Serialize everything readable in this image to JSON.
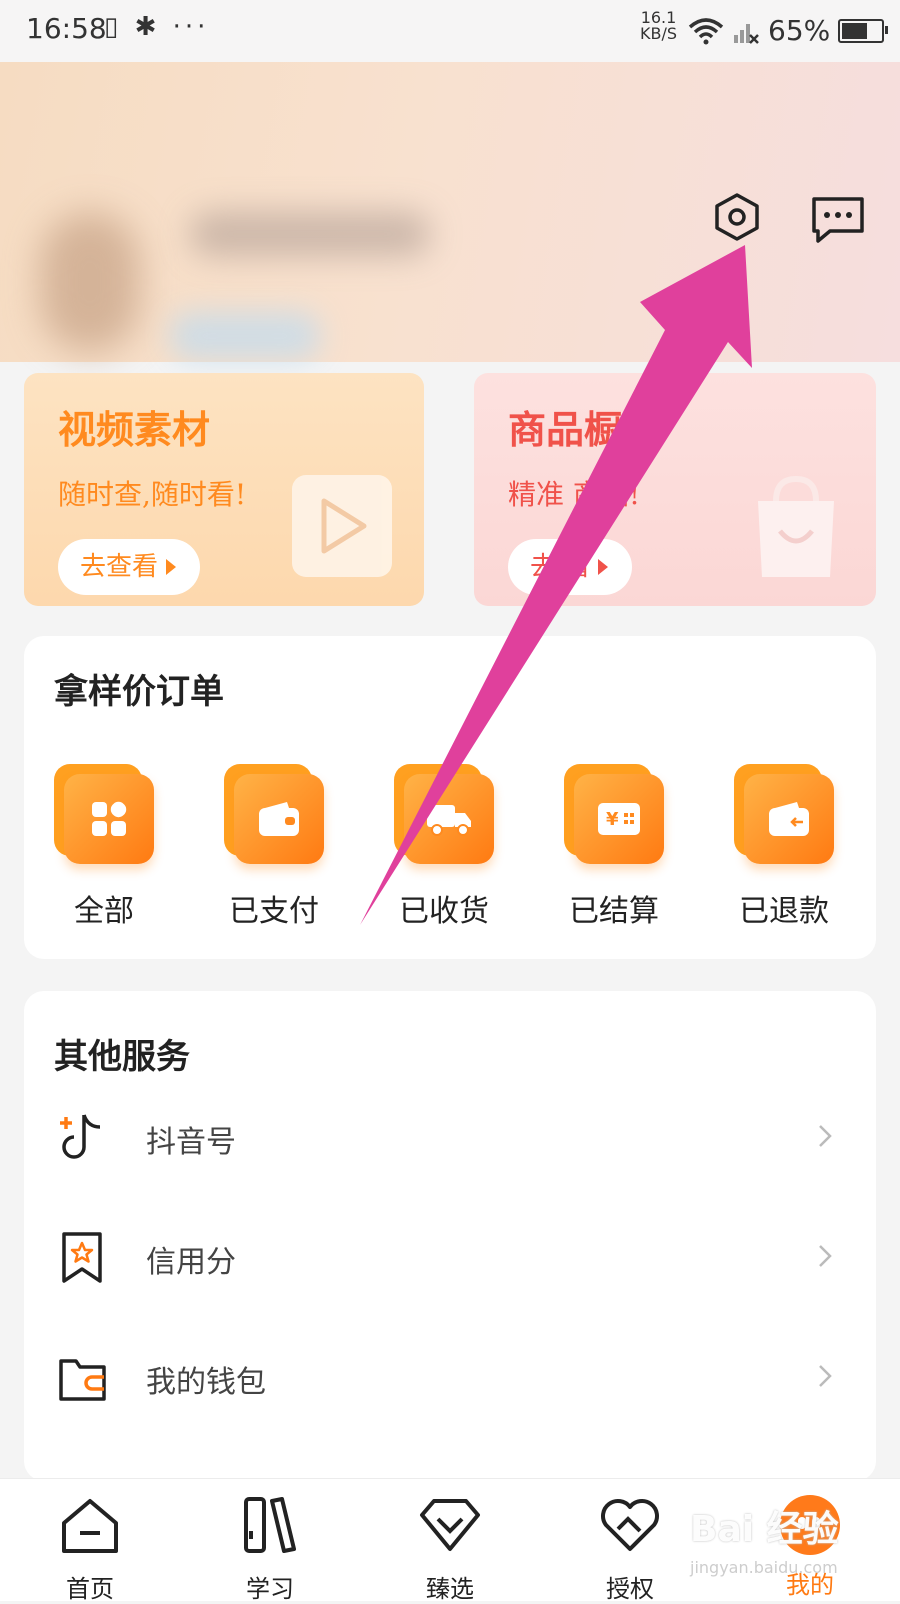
{
  "status_bar": {
    "time": "16:58",
    "left_icons": "▯ ✱ ···",
    "speed_value": "16.1",
    "speed_unit": "KB/S",
    "battery_text": "65%",
    "battery_level": 0.65
  },
  "header": {
    "settings_icon": "settings-icon",
    "message_icon": "message-icon"
  },
  "promos": [
    {
      "title": "视频素材",
      "subtitle": "随时查,随时看!",
      "button": "去查看",
      "color": "#ff8a1f"
    },
    {
      "title": "商品橱",
      "subtitle": "精准   商品!",
      "button": "去 看",
      "color": "#f0524a"
    }
  ],
  "orders": {
    "title": "拿样价订单",
    "items": [
      {
        "label": "全部",
        "icon": "grid-icon"
      },
      {
        "label": "已支付",
        "icon": "wallet-icon"
      },
      {
        "label": "已收货",
        "icon": "truck-icon"
      },
      {
        "label": "已结算",
        "icon": "ticket-icon"
      },
      {
        "label": "已退款",
        "icon": "refund-wallet-icon"
      }
    ]
  },
  "services": {
    "title": "其他服务",
    "items": [
      {
        "label": "抖音号",
        "icon": "tiktok-icon"
      },
      {
        "label": "信用分",
        "icon": "credit-badge-icon"
      },
      {
        "label": "我的钱包",
        "icon": "wallet-folder-icon"
      }
    ]
  },
  "nav": {
    "items": [
      {
        "label": "首页",
        "icon": "home-icon"
      },
      {
        "label": "学习",
        "icon": "books-icon"
      },
      {
        "label": "臻选",
        "icon": "gem-icon"
      },
      {
        "label": "授权",
        "icon": "heart-handshake-icon"
      },
      {
        "label": "我的",
        "icon": "mascot-icon",
        "active": true
      }
    ]
  },
  "watermark": {
    "main": "Bai 经验",
    "sub": "jingyan.baidu.com"
  },
  "colors": {
    "accent": "#ff7a12",
    "annotation": "#e0409c"
  }
}
